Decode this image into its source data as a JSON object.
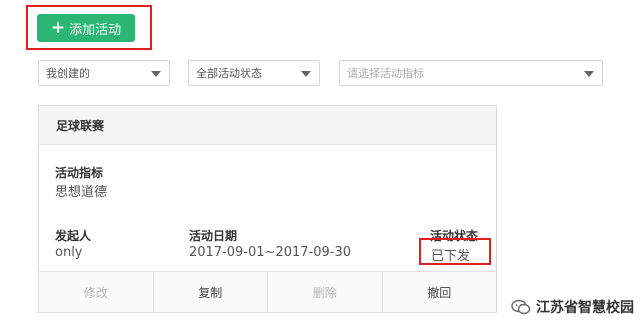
{
  "toolbar": {
    "add_label": "添加活动"
  },
  "filters": {
    "creator": "我创建的",
    "status": "全部活动状态",
    "indicator_placeholder": "请选择活动指标"
  },
  "card": {
    "title": "足球联赛",
    "indicator_label": "活动指标",
    "indicator_value": "思想道德",
    "initiator_label": "发起人",
    "initiator_value": "only",
    "date_label": "活动日期",
    "date_value": "2017-09-01~2017-09-30",
    "status_label": "活动状态",
    "status_value": "已下发",
    "actions": [
      "修改",
      "复制",
      "删除",
      "撤回"
    ]
  },
  "watermark": {
    "text": "江苏省智慧校园"
  },
  "colors": {
    "accent": "#2bb673",
    "highlight": "#e02020"
  }
}
